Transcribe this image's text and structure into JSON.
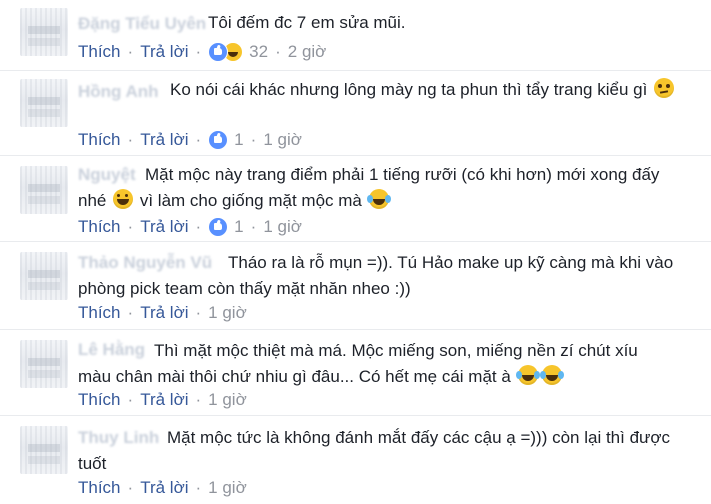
{
  "comments": [
    {
      "name": "Đặng Tiểu Uyên",
      "text_parts": [
        "Tôi đếm đc 7 em sửa mũi."
      ],
      "reply_label": "Thích",
      "reply2_label": "Trả lời",
      "reaction_icons": [
        "like-icon",
        "haha-icon"
      ],
      "reaction_count": "32",
      "time": "2 giờ"
    },
    {
      "name": "Hồng Anh",
      "text_parts": [
        "Ko nói cái khác nhưng lông mày ng ta phun thì tẩy trang kiểu gì"
      ],
      "emoji_end": "confused",
      "reply_label": "Thích",
      "reply2_label": "Trả lời",
      "reaction_icons": [
        "like-icon"
      ],
      "reaction_count": "1",
      "time": "1 giờ"
    },
    {
      "name": "Nguyệt",
      "text_parts": [
        "Mặt mộc này trang điểm phải 1 tiếng rưỡi (có khi hơn) mới xong đấy nhé",
        "vì làm cho giống mặt mộc mà"
      ],
      "reply_label": "Thích",
      "reply2_label": "Trả lời",
      "reaction_icons": [
        "like-icon"
      ],
      "reaction_count": "1",
      "time": "1 giờ"
    },
    {
      "name": "Thảo Nguyễn Vũ",
      "text_parts": [
        "Tháo ra là rỗ mụn =)). Tú Hảo make up kỹ càng mà khi vào phòng pick team còn thấy mặt nhăn nheo :))"
      ],
      "reply_label": "Thích",
      "reply2_label": "Trả lời",
      "time": "1 giờ"
    },
    {
      "name": "Lê Hằng",
      "text_parts": [
        "Thì mặt mộc thiệt mà má. Mộc miếng son, miếng nền zí chút xíu màu chân mài thôi chứ nhiu gì đâu... Có hết mẹ cái mặt à"
      ],
      "reply_label": "Thích",
      "reply2_label": "Trả lời",
      "time": "1 giờ"
    },
    {
      "name": "Thuy Linh",
      "text_parts": [
        "Mặt mộc tức là không đánh mắt đấy các cậu ạ =))) còn lại thì được tuốt"
      ],
      "reply_label": "Thích",
      "reply2_label": "Trả lời",
      "time": "1 giờ"
    }
  ],
  "colors": {
    "link": "#365899",
    "meta": "#90949c",
    "text": "#1d2129",
    "like": "#5890ff",
    "emoji": "#f7c52b"
  }
}
